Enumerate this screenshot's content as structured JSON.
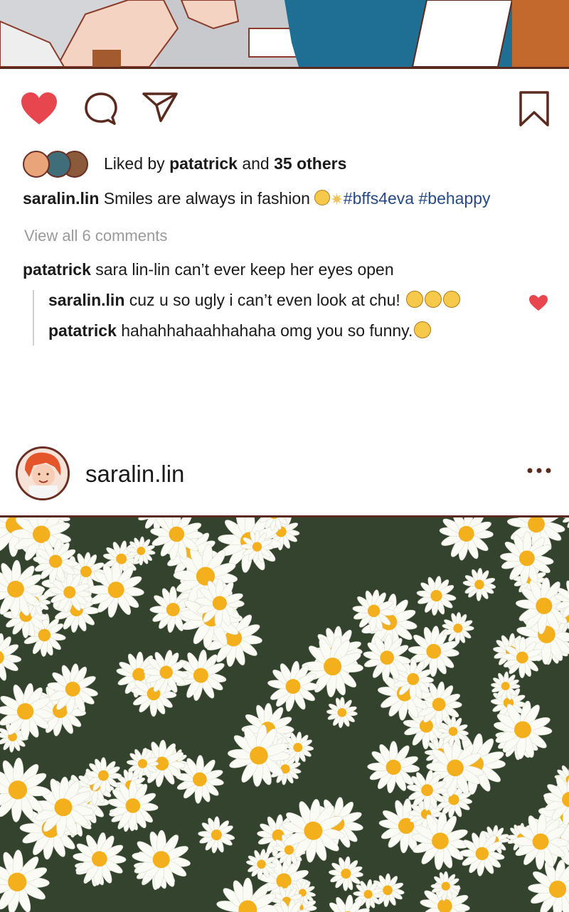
{
  "post1": {
    "likes": {
      "prefix": "Liked by ",
      "user": "patatrick",
      "middle": " and ",
      "others": "35 others"
    },
    "caption": {
      "user": "saralin.lin",
      "text": " Smiles are always in fashion ",
      "hashtags": "#bffs4eva #behappy"
    },
    "view_comments": "View all 6 comments",
    "comments": [
      {
        "user": "patatrick",
        "text": " sara lin-lin can’t ever keep her eyes open"
      }
    ],
    "replies": [
      {
        "user": "saralin.lin",
        "text": " cuz u so ugly i can’t even look at chu! "
      },
      {
        "user": "patatrick",
        "text": " hahahhahaahhahaha omg you so funny."
      }
    ]
  },
  "post2": {
    "username": "saralin.lin"
  },
  "colors": {
    "heart": "#e8464f",
    "hashtag": "#264a86",
    "outline": "#5a2a1e"
  },
  "icons": {
    "like": "heart-icon",
    "comment": "comment-icon",
    "share": "send-icon",
    "save": "bookmark-icon",
    "more": "more-dots-icon"
  }
}
